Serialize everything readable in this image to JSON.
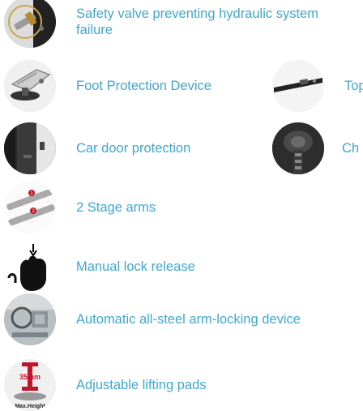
{
  "features": [
    {
      "icon": "safety-valve-icon",
      "label": "Safety valve preventing hydraulic system failure"
    },
    {
      "icon": "foot-protection-icon",
      "label": "Foot Protection  Device"
    },
    {
      "icon": "top-bar-icon",
      "label": "Top"
    },
    {
      "icon": "car-door-protection-icon",
      "label": "Car door protection"
    },
    {
      "icon": "chain-icon",
      "label": "Ch"
    },
    {
      "icon": "two-stage-arms-icon",
      "label": "2 Stage arms"
    },
    {
      "icon": "manual-lock-release-icon",
      "label": "Manual lock release"
    },
    {
      "icon": "arm-locking-device-icon",
      "label": "Automatic all-steel  arm-locking device"
    },
    {
      "icon": "lifting-pad-icon",
      "label": "Adjustable lifting pads"
    }
  ],
  "pad_badge": {
    "value": "35mm",
    "caption": "Max.Height"
  },
  "step_numbers": [
    "1",
    "2"
  ],
  "colors": {
    "label": "#3fa7cf",
    "thumb_bg": "#e9e9e9",
    "accent": "#c0152a"
  }
}
